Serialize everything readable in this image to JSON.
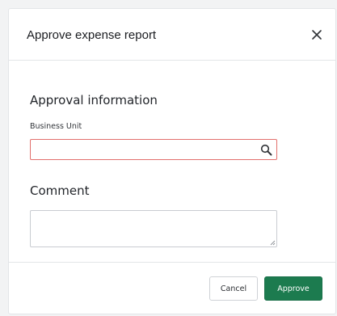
{
  "dialog": {
    "title": "Approve expense report",
    "close_icon": "close-icon"
  },
  "form": {
    "section_title": "Approval information",
    "business_unit": {
      "label": "Business Unit",
      "value": "",
      "icon": "search-icon"
    },
    "comment": {
      "title": "Comment",
      "value": ""
    }
  },
  "footer": {
    "cancel_label": "Cancel",
    "approve_label": "Approve"
  },
  "colors": {
    "approve_button": "#1c7b4f",
    "error_border": "#e2706c"
  }
}
